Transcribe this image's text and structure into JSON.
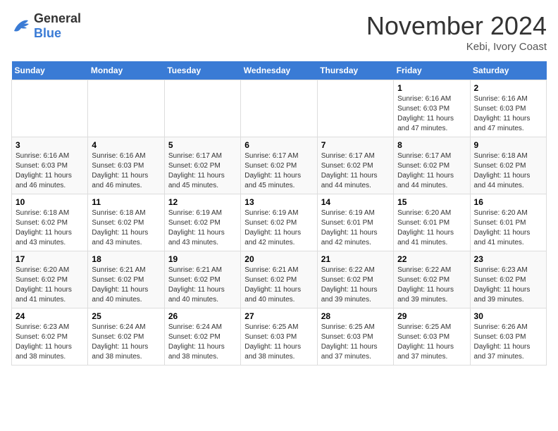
{
  "header": {
    "logo_general": "General",
    "logo_blue": "Blue",
    "month_title": "November 2024",
    "location": "Kebi, Ivory Coast"
  },
  "weekdays": [
    "Sunday",
    "Monday",
    "Tuesday",
    "Wednesday",
    "Thursday",
    "Friday",
    "Saturday"
  ],
  "weeks": [
    [
      {
        "day": "",
        "info": ""
      },
      {
        "day": "",
        "info": ""
      },
      {
        "day": "",
        "info": ""
      },
      {
        "day": "",
        "info": ""
      },
      {
        "day": "",
        "info": ""
      },
      {
        "day": "1",
        "info": "Sunrise: 6:16 AM\nSunset: 6:03 PM\nDaylight: 11 hours and 47 minutes."
      },
      {
        "day": "2",
        "info": "Sunrise: 6:16 AM\nSunset: 6:03 PM\nDaylight: 11 hours and 47 minutes."
      }
    ],
    [
      {
        "day": "3",
        "info": "Sunrise: 6:16 AM\nSunset: 6:03 PM\nDaylight: 11 hours and 46 minutes."
      },
      {
        "day": "4",
        "info": "Sunrise: 6:16 AM\nSunset: 6:03 PM\nDaylight: 11 hours and 46 minutes."
      },
      {
        "day": "5",
        "info": "Sunrise: 6:17 AM\nSunset: 6:02 PM\nDaylight: 11 hours and 45 minutes."
      },
      {
        "day": "6",
        "info": "Sunrise: 6:17 AM\nSunset: 6:02 PM\nDaylight: 11 hours and 45 minutes."
      },
      {
        "day": "7",
        "info": "Sunrise: 6:17 AM\nSunset: 6:02 PM\nDaylight: 11 hours and 44 minutes."
      },
      {
        "day": "8",
        "info": "Sunrise: 6:17 AM\nSunset: 6:02 PM\nDaylight: 11 hours and 44 minutes."
      },
      {
        "day": "9",
        "info": "Sunrise: 6:18 AM\nSunset: 6:02 PM\nDaylight: 11 hours and 44 minutes."
      }
    ],
    [
      {
        "day": "10",
        "info": "Sunrise: 6:18 AM\nSunset: 6:02 PM\nDaylight: 11 hours and 43 minutes."
      },
      {
        "day": "11",
        "info": "Sunrise: 6:18 AM\nSunset: 6:02 PM\nDaylight: 11 hours and 43 minutes."
      },
      {
        "day": "12",
        "info": "Sunrise: 6:19 AM\nSunset: 6:02 PM\nDaylight: 11 hours and 43 minutes."
      },
      {
        "day": "13",
        "info": "Sunrise: 6:19 AM\nSunset: 6:02 PM\nDaylight: 11 hours and 42 minutes."
      },
      {
        "day": "14",
        "info": "Sunrise: 6:19 AM\nSunset: 6:01 PM\nDaylight: 11 hours and 42 minutes."
      },
      {
        "day": "15",
        "info": "Sunrise: 6:20 AM\nSunset: 6:01 PM\nDaylight: 11 hours and 41 minutes."
      },
      {
        "day": "16",
        "info": "Sunrise: 6:20 AM\nSunset: 6:01 PM\nDaylight: 11 hours and 41 minutes."
      }
    ],
    [
      {
        "day": "17",
        "info": "Sunrise: 6:20 AM\nSunset: 6:02 PM\nDaylight: 11 hours and 41 minutes."
      },
      {
        "day": "18",
        "info": "Sunrise: 6:21 AM\nSunset: 6:02 PM\nDaylight: 11 hours and 40 minutes."
      },
      {
        "day": "19",
        "info": "Sunrise: 6:21 AM\nSunset: 6:02 PM\nDaylight: 11 hours and 40 minutes."
      },
      {
        "day": "20",
        "info": "Sunrise: 6:21 AM\nSunset: 6:02 PM\nDaylight: 11 hours and 40 minutes."
      },
      {
        "day": "21",
        "info": "Sunrise: 6:22 AM\nSunset: 6:02 PM\nDaylight: 11 hours and 39 minutes."
      },
      {
        "day": "22",
        "info": "Sunrise: 6:22 AM\nSunset: 6:02 PM\nDaylight: 11 hours and 39 minutes."
      },
      {
        "day": "23",
        "info": "Sunrise: 6:23 AM\nSunset: 6:02 PM\nDaylight: 11 hours and 39 minutes."
      }
    ],
    [
      {
        "day": "24",
        "info": "Sunrise: 6:23 AM\nSunset: 6:02 PM\nDaylight: 11 hours and 38 minutes."
      },
      {
        "day": "25",
        "info": "Sunrise: 6:24 AM\nSunset: 6:02 PM\nDaylight: 11 hours and 38 minutes."
      },
      {
        "day": "26",
        "info": "Sunrise: 6:24 AM\nSunset: 6:02 PM\nDaylight: 11 hours and 38 minutes."
      },
      {
        "day": "27",
        "info": "Sunrise: 6:25 AM\nSunset: 6:03 PM\nDaylight: 11 hours and 38 minutes."
      },
      {
        "day": "28",
        "info": "Sunrise: 6:25 AM\nSunset: 6:03 PM\nDaylight: 11 hours and 37 minutes."
      },
      {
        "day": "29",
        "info": "Sunrise: 6:25 AM\nSunset: 6:03 PM\nDaylight: 11 hours and 37 minutes."
      },
      {
        "day": "30",
        "info": "Sunrise: 6:26 AM\nSunset: 6:03 PM\nDaylight: 11 hours and 37 minutes."
      }
    ]
  ]
}
